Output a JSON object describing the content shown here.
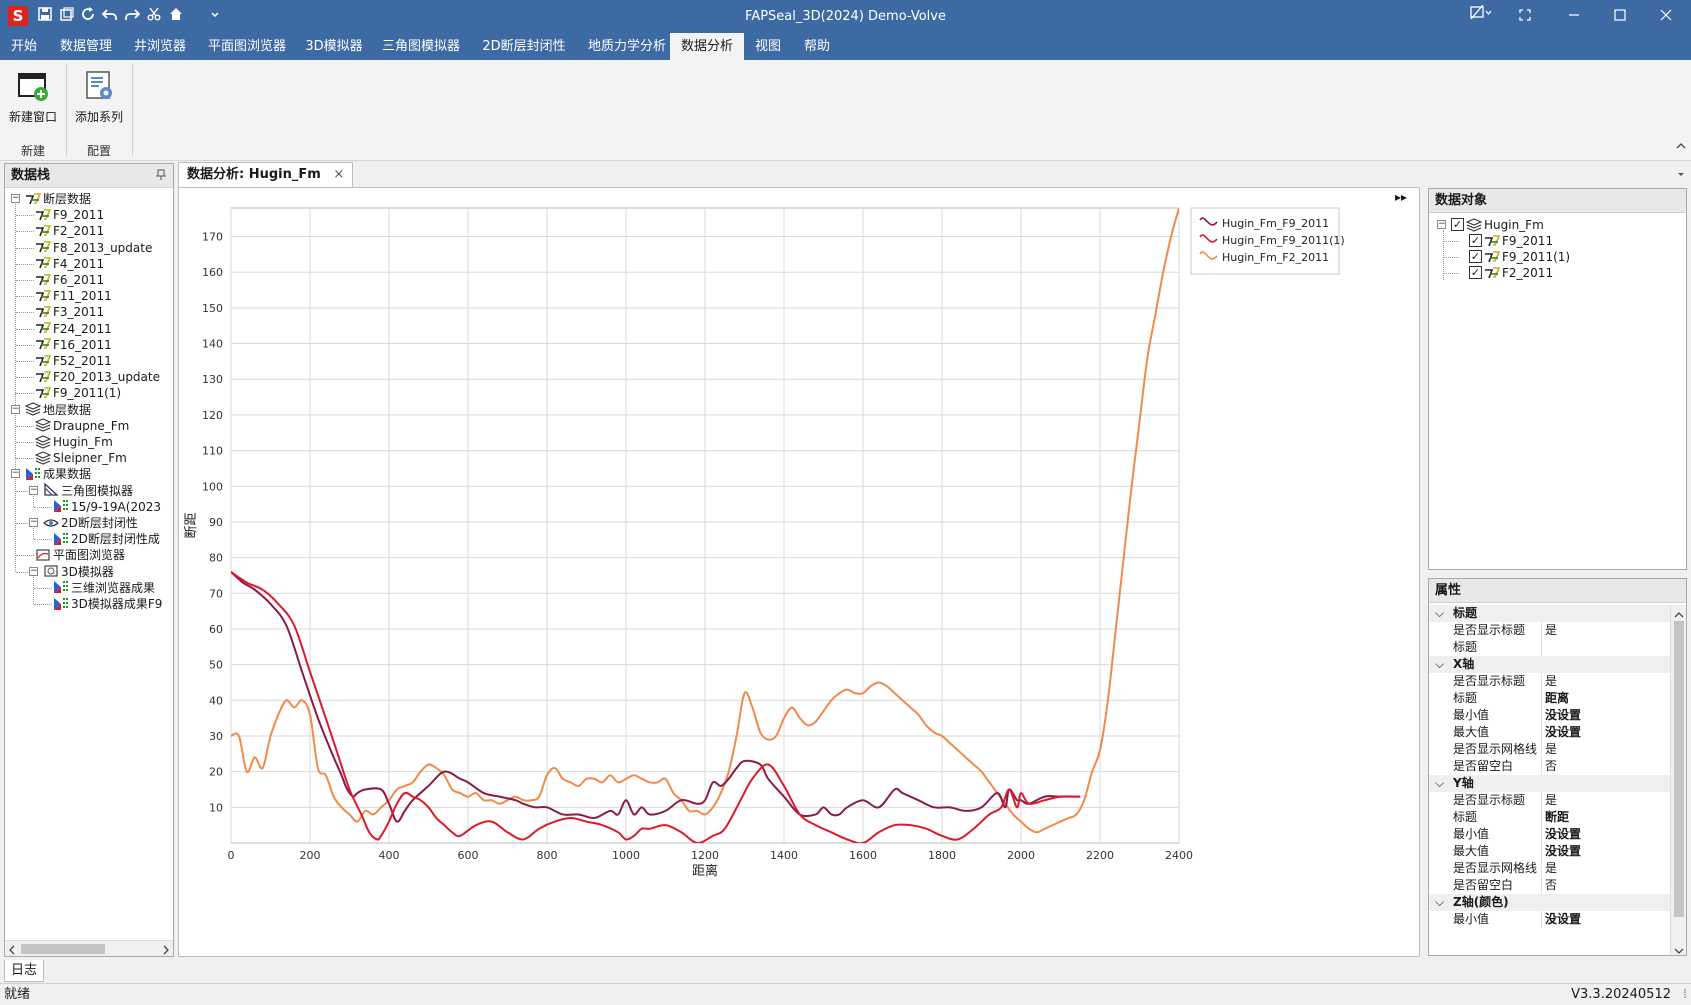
{
  "app": {
    "title": "FAPSeal_3D(2024) Demo-Volve",
    "logo_letter": "S"
  },
  "quick_access": [
    "save-icon",
    "save-as-icon",
    "refresh-icon",
    "undo-icon",
    "redo-icon",
    "cut-icon",
    "home-icon",
    "dropdown-icon"
  ],
  "menu": [
    "开始",
    "数据管理",
    "井浏览器",
    "平面图浏览器",
    "3D模拟器",
    "三角图模拟器",
    "2D断层封闭性",
    "地质力学分析",
    "数据分析",
    "视图",
    "帮助"
  ],
  "menu_active": "数据分析",
  "ribbon": {
    "buttons": [
      {
        "label": "新建窗口",
        "icon": "new-window-icon"
      },
      {
        "label": "添加系列",
        "icon": "add-series-icon"
      }
    ],
    "groups": [
      "新建",
      "配置"
    ]
  },
  "data_stack": {
    "title": "数据栈",
    "pin_glyph": "ㅁ",
    "fault_root": "断层数据",
    "faults": [
      "F9_2011",
      "F2_2011",
      "F8_2013_update",
      "F4_2011",
      "F6_2011",
      "F11_2011",
      "F3_2011",
      "F24_2011",
      "F16_2011",
      "F52_2011",
      "F20_2013_update",
      "F9_2011(1)"
    ],
    "horizon_root": "地层数据",
    "horizons": [
      "Draupne_Fm",
      "Hugin_Fm",
      "Sleipner_Fm"
    ],
    "results_root": "成果数据",
    "results": [
      {
        "label": "三角图模拟器",
        "children": [
          "15/9-19A(2023"
        ]
      },
      {
        "label": "2D断层封闭性",
        "children": [
          "2D断层封闭性成"
        ]
      },
      {
        "label": "平面图浏览器",
        "children": []
      },
      {
        "label": "3D模拟器",
        "children": [
          "三维浏览器成果",
          "3D模拟器成果F9"
        ]
      }
    ]
  },
  "doc_tab": {
    "label": "数据分析: Hugin_Fm",
    "close": "×"
  },
  "chart_toolbar_glyph": "▸▸",
  "data_objects": {
    "title": "数据对象",
    "root": "Hugin_Fm",
    "items": [
      "F9_2011",
      "F9_2011(1)",
      "F2_2011"
    ]
  },
  "properties": {
    "title": "属性",
    "sections": [
      {
        "name": "标题",
        "rows": [
          [
            "是否显示标题",
            "是"
          ],
          [
            "标题",
            ""
          ]
        ]
      },
      {
        "name": "X轴",
        "rows": [
          [
            "是否显示标题",
            "是"
          ],
          [
            "标题",
            "距离"
          ],
          [
            "最小值",
            "没设置"
          ],
          [
            "最大值",
            "没设置"
          ],
          [
            "是否显示网格线",
            "是"
          ],
          [
            "是否留空白",
            "否"
          ]
        ]
      },
      {
        "name": "Y轴",
        "rows": [
          [
            "是否显示标题",
            "是"
          ],
          [
            "标题",
            "断距"
          ],
          [
            "最小值",
            "没设置"
          ],
          [
            "最大值",
            "没设置"
          ],
          [
            "是否显示网格线",
            "是"
          ],
          [
            "是否留空白",
            "否"
          ]
        ]
      },
      {
        "name": "Z轴(颜色)",
        "rows": [
          [
            "最小值",
            "没设置"
          ]
        ]
      }
    ]
  },
  "log_tab": "日志",
  "status": {
    "left": "就绪",
    "right": "V3.3.20240512"
  },
  "chart_data": {
    "type": "line",
    "title": "",
    "xlabel": "距离",
    "ylabel": "断距",
    "xlim": [
      0,
      2400
    ],
    "ylim": [
      0,
      178
    ],
    "xticks": [
      0,
      200,
      400,
      600,
      800,
      1000,
      1200,
      1400,
      1600,
      1800,
      2000,
      2200,
      2400
    ],
    "yticks": [
      10,
      20,
      30,
      40,
      50,
      60,
      70,
      80,
      90,
      100,
      110,
      120,
      130,
      140,
      150,
      160,
      170
    ],
    "grid": true,
    "legend": "top-right",
    "series": [
      {
        "name": "Hugin_Fm_F9_2011",
        "color": "#8b1a4a",
        "x": [
          0,
          30,
          60,
          100,
          140,
          180,
          220,
          260,
          280,
          290,
          300,
          310,
          320,
          340,
          380,
          400,
          420,
          440,
          460,
          500,
          540,
          580,
          600,
          640,
          680,
          720,
          740,
          770,
          800,
          840,
          880,
          920,
          960,
          980,
          1000,
          1020,
          1040,
          1060,
          1100,
          1140,
          1180,
          1200,
          1220,
          1240,
          1260,
          1280,
          1300,
          1340,
          1360,
          1400,
          1440,
          1480,
          1500,
          1520,
          1540,
          1560,
          1600,
          1640,
          1680,
          1700,
          1740,
          1780,
          1820,
          1860,
          1900,
          1940,
          1960,
          1970,
          1990,
          2000,
          2020,
          2060,
          2100,
          2140,
          2150
        ],
        "y": [
          76,
          73,
          71,
          67,
          61,
          48,
          35,
          24,
          19,
          16,
          14,
          13,
          14,
          15,
          15,
          11,
          6,
          9,
          12,
          16,
          20,
          18,
          17,
          14,
          13,
          12,
          11,
          10,
          10,
          8,
          8,
          7,
          9,
          8,
          12,
          8,
          10,
          8,
          9,
          12,
          11,
          12,
          17,
          16,
          18,
          21,
          23,
          22,
          18,
          13,
          8,
          8,
          10,
          8,
          8,
          10,
          12,
          10,
          15,
          14,
          12,
          10,
          10,
          9,
          10,
          14,
          10,
          15,
          12,
          12,
          11,
          13,
          13,
          13,
          13
        ]
      },
      {
        "name": "Hugin_Fm_F9_2011(1)",
        "color": "#e0192a",
        "x": [
          0,
          40,
          80,
          120,
          160,
          200,
          240,
          270,
          300,
          330,
          350,
          370,
          380,
          400,
          420,
          440,
          460,
          480,
          500,
          520,
          540,
          560,
          580,
          620,
          660,
          700,
          740,
          780,
          820,
          860,
          900,
          940,
          980,
          1000,
          1020,
          1040,
          1060,
          1100,
          1140,
          1180,
          1220,
          1250,
          1290,
          1320,
          1360,
          1400,
          1440,
          1480,
          1520,
          1560,
          1600,
          1640,
          1680,
          1720,
          1760,
          1800,
          1840,
          1880,
          1920,
          1950,
          1970,
          1990,
          2000,
          2020,
          2060,
          2100,
          2140,
          2150
        ],
        "y": [
          76,
          73,
          71,
          67,
          61,
          48,
          35,
          25,
          15,
          8,
          3,
          1,
          2,
          6,
          11,
          14,
          13,
          12,
          10,
          7,
          5,
          3,
          2,
          5,
          6,
          3,
          1,
          4,
          6,
          7,
          6,
          5,
          3,
          1,
          2,
          4,
          4,
          5,
          3,
          0,
          2,
          4,
          12,
          18,
          22,
          16,
          8,
          5,
          3,
          1,
          0,
          3,
          5,
          5,
          4,
          2,
          1,
          4,
          8,
          10,
          15,
          10,
          14,
          11,
          12,
          13,
          13,
          13
        ]
      },
      {
        "name": "Hugin_Fm_F2_2011",
        "color": "#f08a4b",
        "x": [
          0,
          20,
          40,
          60,
          80,
          100,
          120,
          140,
          160,
          180,
          200,
          220,
          240,
          260,
          280,
          300,
          320,
          340,
          360,
          380,
          400,
          420,
          440,
          460,
          480,
          500,
          520,
          540,
          560,
          580,
          600,
          620,
          640,
          660,
          680,
          700,
          720,
          740,
          760,
          780,
          800,
          820,
          840,
          860,
          880,
          900,
          920,
          940,
          960,
          980,
          1000,
          1020,
          1040,
          1060,
          1080,
          1100,
          1120,
          1140,
          1160,
          1180,
          1200,
          1220,
          1240,
          1260,
          1280,
          1300,
          1320,
          1340,
          1360,
          1380,
          1400,
          1420,
          1440,
          1460,
          1480,
          1500,
          1520,
          1540,
          1560,
          1580,
          1600,
          1620,
          1640,
          1660,
          1680,
          1700,
          1720,
          1740,
          1760,
          1780,
          1800,
          1820,
          1840,
          1860,
          1880,
          1900,
          1920,
          1940,
          1960,
          1980,
          2000,
          2020,
          2040,
          2060,
          2080,
          2100,
          2120,
          2140,
          2160,
          2180,
          2200,
          2220,
          2240,
          2260,
          2280,
          2300,
          2320,
          2340,
          2360,
          2380,
          2400
        ],
        "y": [
          30,
          30,
          20,
          24,
          21,
          30,
          36,
          40,
          38,
          40,
          36,
          21,
          19,
          13,
          10,
          8,
          6,
          9,
          8,
          10,
          12,
          15,
          16,
          17,
          20,
          22,
          21,
          19,
          15,
          14,
          13,
          14,
          12,
          12,
          11,
          12,
          13,
          12,
          12,
          13,
          19,
          21,
          18,
          17,
          16,
          18,
          18,
          17,
          19,
          17,
          18,
          19,
          18,
          17,
          17,
          18,
          14,
          12,
          9,
          9,
          8,
          10,
          14,
          20,
          30,
          42,
          38,
          31,
          29,
          30,
          35,
          38,
          35,
          33,
          34,
          37,
          40,
          42,
          43,
          42,
          42,
          44,
          45,
          44,
          42,
          40,
          38,
          36,
          33,
          31,
          30,
          28,
          26,
          24,
          22,
          20,
          17,
          14,
          11,
          8,
          6,
          4,
          3,
          4,
          5,
          6,
          7,
          8,
          12,
          20,
          26,
          40,
          60,
          80,
          100,
          118,
          136,
          148,
          160,
          170,
          178
        ]
      }
    ]
  }
}
